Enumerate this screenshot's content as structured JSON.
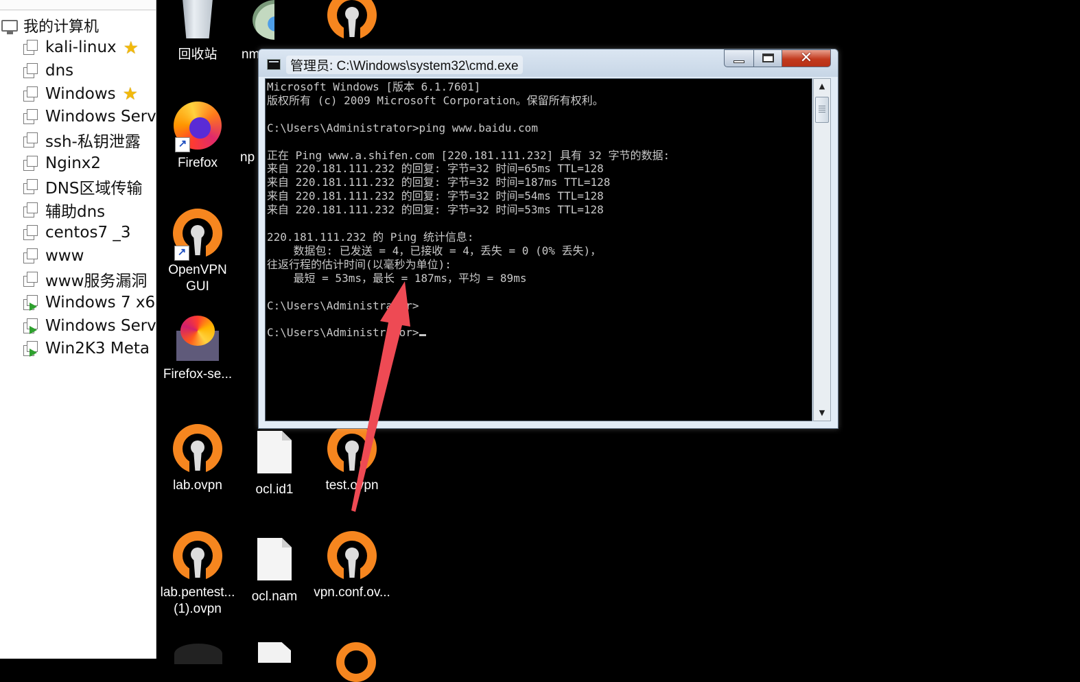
{
  "library": {
    "root_label": "我的计算机",
    "items": [
      {
        "label": "kali-linux",
        "starred": true,
        "running": false
      },
      {
        "label": "dns",
        "starred": false,
        "running": false
      },
      {
        "label": "Windows",
        "starred": true,
        "running": false
      },
      {
        "label": "Windows Serv",
        "starred": false,
        "running": false
      },
      {
        "label": "ssh-私钥泄露",
        "starred": false,
        "running": false
      },
      {
        "label": "Nginx2",
        "starred": false,
        "running": false
      },
      {
        "label": "DNS区域传输",
        "starred": false,
        "running": false
      },
      {
        "label": "辅助dns",
        "starred": false,
        "running": false
      },
      {
        "label": "centos7 _3",
        "starred": false,
        "running": false
      },
      {
        "label": "www",
        "starred": false,
        "running": false
      },
      {
        "label": "www服务漏洞",
        "starred": false,
        "running": false
      },
      {
        "label": "Windows 7 x6",
        "starred": false,
        "running": true
      },
      {
        "label": "Windows Serv",
        "starred": false,
        "running": true
      },
      {
        "label": "Win2K3 Meta",
        "starred": false,
        "running": true
      }
    ]
  },
  "desktop": {
    "icons": [
      {
        "id": "recycle",
        "label": "回收站",
        "icon": "recycle-bin-icon"
      },
      {
        "id": "nm",
        "label": "nm",
        "icon": "nsis-icon"
      },
      {
        "id": "firefox",
        "label": "Firefox",
        "icon": "firefox-icon"
      },
      {
        "id": "np",
        "label": "np",
        "icon": "generic-icon"
      },
      {
        "id": "openvpn-gui",
        "label": "OpenVPN\nGUI",
        "icon": "openvpn-icon"
      },
      {
        "id": "firefox-se",
        "label": "Firefox-se...",
        "icon": "firefox-setup-icon"
      },
      {
        "id": "lab-ovpn",
        "label": "lab.ovpn",
        "icon": "openvpn-icon"
      },
      {
        "id": "ocl-id1",
        "label": "ocl.id1",
        "icon": "file-icon"
      },
      {
        "id": "test-ovpn",
        "label": "test.ovpn",
        "icon": "openvpn-icon"
      },
      {
        "id": "lab-pentest",
        "label": "lab.pentest...\n(1).ovpn",
        "icon": "openvpn-icon"
      },
      {
        "id": "ocl-nam",
        "label": "ocl.nam",
        "icon": "file-icon"
      },
      {
        "id": "vpn-conf",
        "label": "vpn.conf.ov...",
        "icon": "openvpn-icon"
      }
    ]
  },
  "cmd_window": {
    "title": "管理员: C:\\Windows\\system32\\cmd.exe",
    "close_glyph": "✕",
    "scroll_up": "▲",
    "scroll_down": "▼",
    "lines": [
      "Microsoft Windows [版本 6.1.7601]",
      "版权所有 (c) 2009 Microsoft Corporation。保留所有权利。",
      "",
      "C:\\Users\\Administrator>ping www.baidu.com",
      "",
      "正在 Ping www.a.shifen.com [220.181.111.232] 具有 32 字节的数据:",
      "来自 220.181.111.232 的回复: 字节=32 时间=65ms TTL=128",
      "来自 220.181.111.232 的回复: 字节=32 时间=187ms TTL=128",
      "来自 220.181.111.232 的回复: 字节=32 时间=54ms TTL=128",
      "来自 220.181.111.232 的回复: 字节=32 时间=53ms TTL=128",
      "",
      "220.181.111.232 的 Ping 统计信息:",
      "    数据包: 已发送 = 4，已接收 = 4，丢失 = 0 (0% 丢失)，",
      "往返行程的估计时间(以毫秒为单位):",
      "    最短 = 53ms，最长 = 187ms，平均 = 89ms",
      "",
      "C:\\Users\\Administrator>",
      "",
      "C:\\Users\\Administrator>"
    ]
  },
  "colors": {
    "annotation_arrow": "#ee4a54",
    "openvpn_orange": "#f6861f",
    "running_green": "#2fa12f",
    "star_yellow": "#f2b90c"
  }
}
